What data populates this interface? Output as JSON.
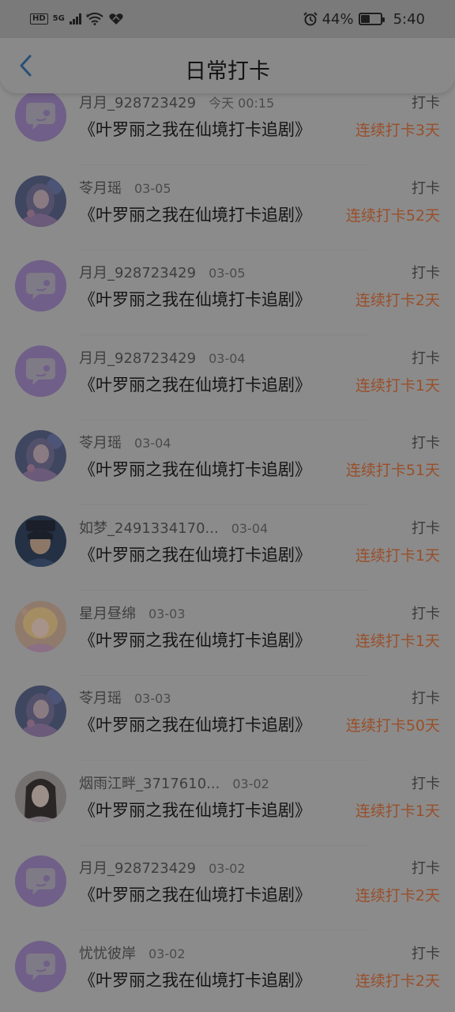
{
  "status_bar": {
    "hd": "HD",
    "network": "5G",
    "wifi_badge": "6",
    "battery_text": "44%",
    "battery_level": 0.44,
    "time": "5:40"
  },
  "header": {
    "title": "日常打卡"
  },
  "items": [
    {
      "name": "月月_928723429",
      "date": "今天 00:15",
      "drama": "《叶罗丽之我在仙境打卡追剧》",
      "action": "打卡",
      "streak": "连续打卡3天",
      "avatar": "chat-bubble-avatar"
    },
    {
      "name": "苓月瑶",
      "date": "03-05",
      "drama": "《叶罗丽之我在仙境打卡追剧》",
      "action": "打卡",
      "streak": "连续打卡52天",
      "avatar": "anime-girl-avatar"
    },
    {
      "name": "月月_928723429",
      "date": "03-05",
      "drama": "《叶罗丽之我在仙境打卡追剧》",
      "action": "打卡",
      "streak": "连续打卡2天",
      "avatar": "chat-bubble-avatar"
    },
    {
      "name": "月月_928723429",
      "date": "03-04",
      "drama": "《叶罗丽之我在仙境打卡追剧》",
      "action": "打卡",
      "streak": "连续打卡1天",
      "avatar": "chat-bubble-avatar"
    },
    {
      "name": "苓月瑶",
      "date": "03-04",
      "drama": "《叶罗丽之我在仙境打卡追剧》",
      "action": "打卡",
      "streak": "连续打卡51天",
      "avatar": "anime-girl-avatar"
    },
    {
      "name": "如梦_2491334170...",
      "date": "03-04",
      "drama": "《叶罗丽之我在仙境打卡追剧》",
      "action": "打卡",
      "streak": "连续打卡1天",
      "avatar": "dark-character-avatar"
    },
    {
      "name": "星月昼绵",
      "date": "03-03",
      "drama": "《叶罗丽之我在仙境打卡追剧》",
      "action": "打卡",
      "streak": "连续打卡1天",
      "avatar": "blonde-girl-avatar"
    },
    {
      "name": "苓月瑶",
      "date": "03-03",
      "drama": "《叶罗丽之我在仙境打卡追剧》",
      "action": "打卡",
      "streak": "连续打卡50天",
      "avatar": "anime-girl-avatar"
    },
    {
      "name": "烟雨江畔_3717610...",
      "date": "03-02",
      "drama": "《叶罗丽之我在仙境打卡追剧》",
      "action": "打卡",
      "streak": "连续打卡1天",
      "avatar": "ancient-lady-avatar"
    },
    {
      "name": "月月_928723429",
      "date": "03-02",
      "drama": "《叶罗丽之我在仙境打卡追剧》",
      "action": "打卡",
      "streak": "连续打卡2天",
      "avatar": "chat-bubble-avatar"
    },
    {
      "name": "忧忧彼岸",
      "date": "03-02",
      "drama": "《叶罗丽之我在仙境打卡追剧》",
      "action": "打卡",
      "streak": "连续打卡2天",
      "avatar": "chat-bubble-avatar"
    }
  ]
}
